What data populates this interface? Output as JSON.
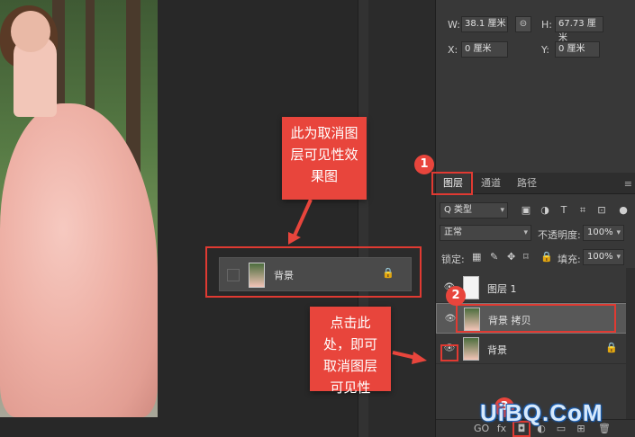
{
  "properties": {
    "w_label": "W:",
    "w_value": "38.1 厘米",
    "h_label": "H:",
    "h_value": "67.73 厘米",
    "x_label": "X:",
    "x_value": "0 厘米",
    "y_label": "Y:",
    "y_value": "0 厘米",
    "link_icon": "⊝"
  },
  "tabs": [
    {
      "label": "图层"
    },
    {
      "label": "通道"
    },
    {
      "label": "路径"
    }
  ],
  "tabs_menu": "≡",
  "filter": {
    "kind_label": "Q 类型",
    "blend_mode": "正常",
    "opacity_label": "不透明度:",
    "opacity_value": "100%",
    "lock_label": "锁定:",
    "fill_label": "填充:",
    "fill_value": "100%"
  },
  "layers": [
    {
      "name": "图层 1",
      "eye": "👁"
    },
    {
      "name": "背景 拷贝",
      "eye": "👁"
    },
    {
      "name": "背景",
      "eye": "👁",
      "lock": "🔒"
    }
  ],
  "preview_row": {
    "name": "背景",
    "lock": "🔒"
  },
  "callouts": {
    "top": "此为取消图层可见性效果图",
    "bottom": "点击此处，即可取消图层可见性"
  },
  "badges": [
    "1",
    "2",
    "3"
  ],
  "bottom_icons": [
    "GO",
    "fx",
    "◘",
    "◐",
    "▭",
    "⊞",
    "🗑"
  ],
  "watermark": "UiBQ.CoM",
  "colors": {
    "accent_red": "#e8453c",
    "panel_bg": "#383838",
    "canvas_bg": "#282828",
    "watermark_blue": "#1a5fb4"
  }
}
